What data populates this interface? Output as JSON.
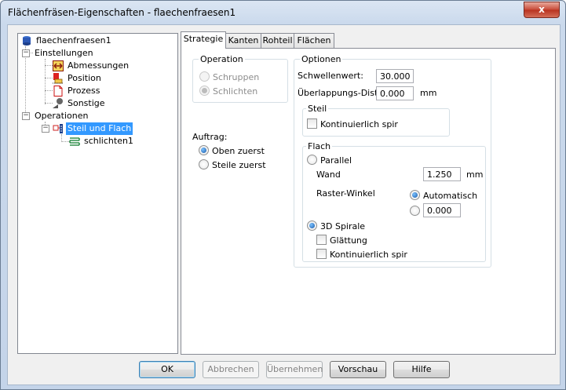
{
  "window": {
    "title": "Flächenfräsen-Eigenschaften - flaechenfraesen1",
    "close_glyph": "x"
  },
  "tree": {
    "root": "flaechenfraesen1",
    "settings": "Einstellungen",
    "settings_items": [
      "Abmessungen",
      "Position",
      "Prozess",
      "Sonstige"
    ],
    "operations": "Operationen",
    "operation": "Steil und Flach",
    "operation_child": "schlichten1"
  },
  "tabs": [
    "Strategie",
    "Kanten",
    "Rohteil",
    "Flächen"
  ],
  "strategy": {
    "operation_group": "Operation",
    "op_rough": "Schruppen",
    "op_finish": "Schlichten",
    "order_label": "Auftrag:",
    "order_top": "Oben zuerst",
    "order_steep": "Steile zuerst",
    "options_group": "Optionen",
    "threshold_label": "Schwellenwert:",
    "threshold_value": "30.000",
    "overlap_label": "Überlappungs-Distar",
    "overlap_value": "0.000",
    "overlap_unit": "mm",
    "steep_group": "Steil",
    "steep_continuous": "Kontinuierlich spir",
    "flat_group": "Flach",
    "parallel": "Parallel",
    "wall_label": "Wand",
    "wall_value": "1.250",
    "wall_unit": "mm",
    "raster_label": "Raster-Winkel",
    "raster_auto": "Automatisch",
    "raster_value": "0.000",
    "spiral_3d": "3D Spirale",
    "smoothing": "Glättung",
    "flat_continuous": "Kontinuierlich spir"
  },
  "buttons": {
    "ok": "OK",
    "cancel": "Abbrechen",
    "apply": "Übernehmen",
    "preview": "Vorschau",
    "help": "Hilfe"
  }
}
